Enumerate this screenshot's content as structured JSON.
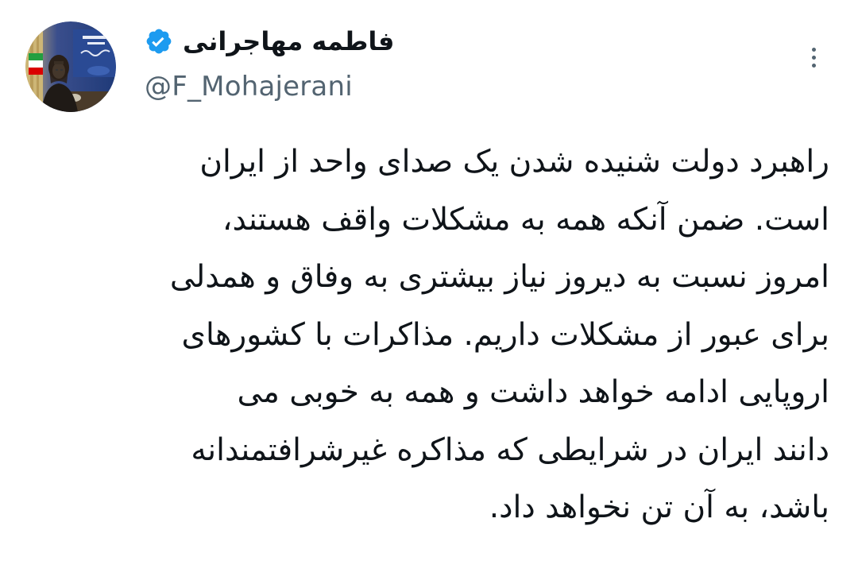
{
  "author": {
    "display_name": "فاطمه مهاجرانی",
    "handle": "@F_Mohajerani",
    "verified": true,
    "avatar_icon": "profile-photo",
    "verified_icon": "verified-badge-icon",
    "accent_color": "#1d9bf0"
  },
  "actions": {
    "more_icon": "more-options-icon"
  },
  "tweet": {
    "lines": [
      "راهبرد دولت شنیده شدن یک صدای واحد از ایران",
      "است. ضمن آنکه همه به مشکلات واقف هستند،",
      "امروز نسبت به دیروز نیاز بیشتری به وفاق و همدلی",
      "برای عبور از مشکلات داریم. مذاکرات با کشورهای",
      "اروپایی ادامه خواهد داشت و همه به خوبی می",
      "دانند ایران در شرایطی که مذاکره غیرشرافتمندانه",
      "باشد، به آن تن نخواهد داد."
    ]
  },
  "colors": {
    "text_primary": "#0f1419",
    "text_secondary": "#536471",
    "background": "#ffffff"
  }
}
